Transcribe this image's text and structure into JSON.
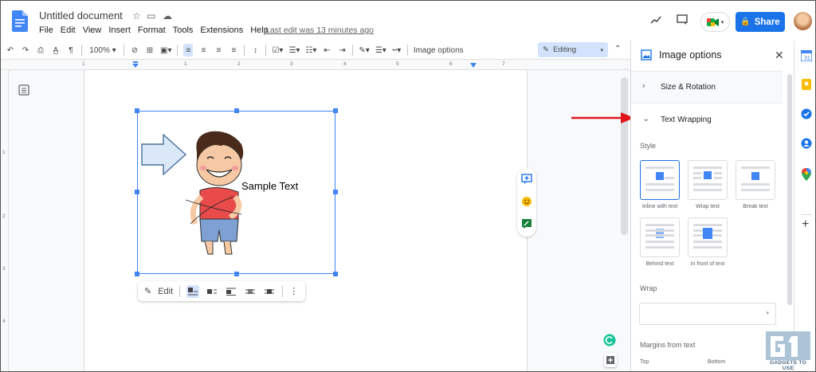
{
  "doc": {
    "title": "Untitled document",
    "menu": [
      "File",
      "Edit",
      "View",
      "Insert",
      "Format",
      "Tools",
      "Extensions",
      "Help"
    ],
    "last_edit": "Last edit was 13 minutes ago",
    "share_label": "Share"
  },
  "toolbar": {
    "zoom": "100%",
    "image_options": "Image options",
    "mode": "Editing"
  },
  "ruler": {
    "numbers": [
      "1",
      "1",
      "2",
      "3",
      "4",
      "5",
      "6",
      "7"
    ]
  },
  "vruler": {
    "numbers": [
      "1",
      "2",
      "3",
      "4"
    ]
  },
  "image": {
    "sample_text": "Sample Text",
    "edit_label": "Edit"
  },
  "panel": {
    "title": "Image options",
    "size_rotation": "Size & Rotation",
    "text_wrapping": "Text Wrapping",
    "style_label": "Style",
    "styles": [
      "Inline with text",
      "Wrap text",
      "Break text",
      "Behind text",
      "In front of text"
    ],
    "wrap_label": "Wrap",
    "margins_label": "Margins from text",
    "top_label": "Top",
    "bottom_label": "Bottom"
  },
  "watermark": {
    "text": "GADGETS TO USE"
  },
  "colors": {
    "accent": "#1a73e8",
    "selection": "#4285f4",
    "arrow": "#e0151b"
  }
}
